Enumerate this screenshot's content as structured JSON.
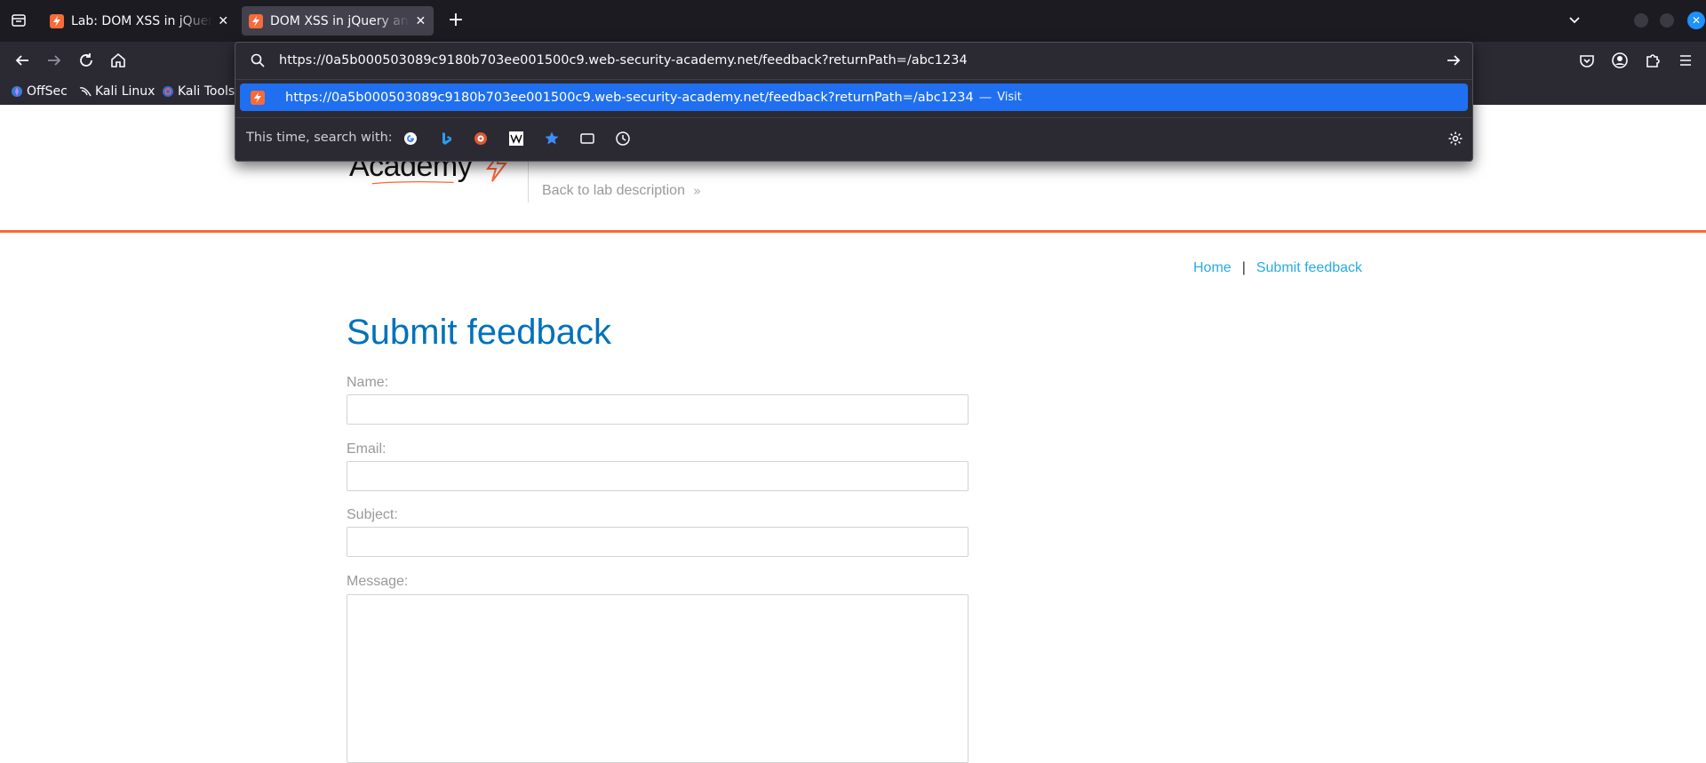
{
  "browser": {
    "tabs": [
      {
        "title": "Lab: DOM XSS in jQuery anchor href attribute sink using location.search source",
        "active": false
      },
      {
        "title": "DOM XSS in jQuery anchor href attribute sink using location.search source",
        "active": true
      }
    ],
    "bookmarks": [
      "OffSec",
      "Kali Linux",
      "Kali Tools"
    ],
    "address_bar": {
      "value": "https://0a5b000503089c9180b703ee001500c9.web-security-academy.net/feedback?returnPath=/abc1234"
    },
    "suggestion": {
      "url": "https://0a5b000503089c9180b703ee001500c9.web-security-academy.net/feedback?returnPath=/abc1234",
      "separator": "—",
      "action": "Visit"
    },
    "search_with_label": "This time, search with:",
    "accent_color": "#1f6ff0"
  },
  "site": {
    "logo_text": "Academy",
    "back_link": "Back to lab description",
    "brand_color": "#ff6633",
    "nav": {
      "home": "Home",
      "separator": "|",
      "submit_feedback": "Submit feedback"
    },
    "page_title": "Submit feedback",
    "form": {
      "name_label": "Name:",
      "email_label": "Email:",
      "subject_label": "Subject:",
      "message_label": "Message:"
    }
  }
}
